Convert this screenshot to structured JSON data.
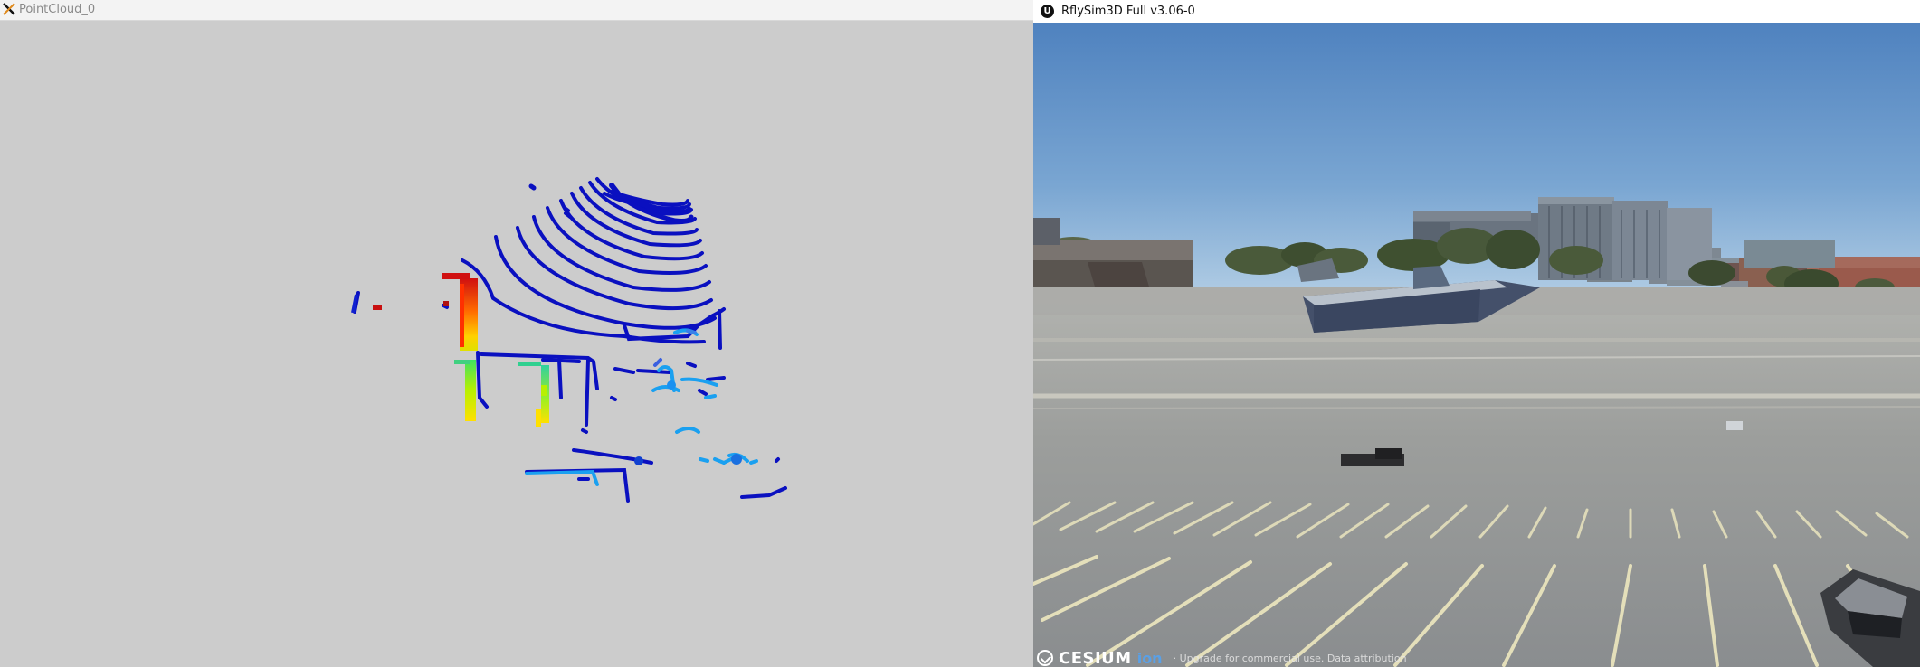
{
  "windows": {
    "pointcloud": {
      "title": "PointCloud_0",
      "logo_icon": "x-window-icon",
      "background": "#cccccc"
    },
    "rflysim": {
      "title": "RflySim3D Full v3.06-0",
      "logo_icon": "unreal-engine-icon",
      "logo_glyph": "U",
      "credit": {
        "brand": "CESIUM",
        "ion": "ion",
        "note": "· Upgrade for commercial use. Data attribution"
      }
    }
  },
  "colors": {
    "lidar_blue": "#0a14c8",
    "lidar_cyan": "#1aa6ff",
    "lidar_red": "#c81010",
    "sky_top": "#4f82bf",
    "sky_bottom": "#a8c8e4",
    "pavement": "#9a9d9e"
  }
}
